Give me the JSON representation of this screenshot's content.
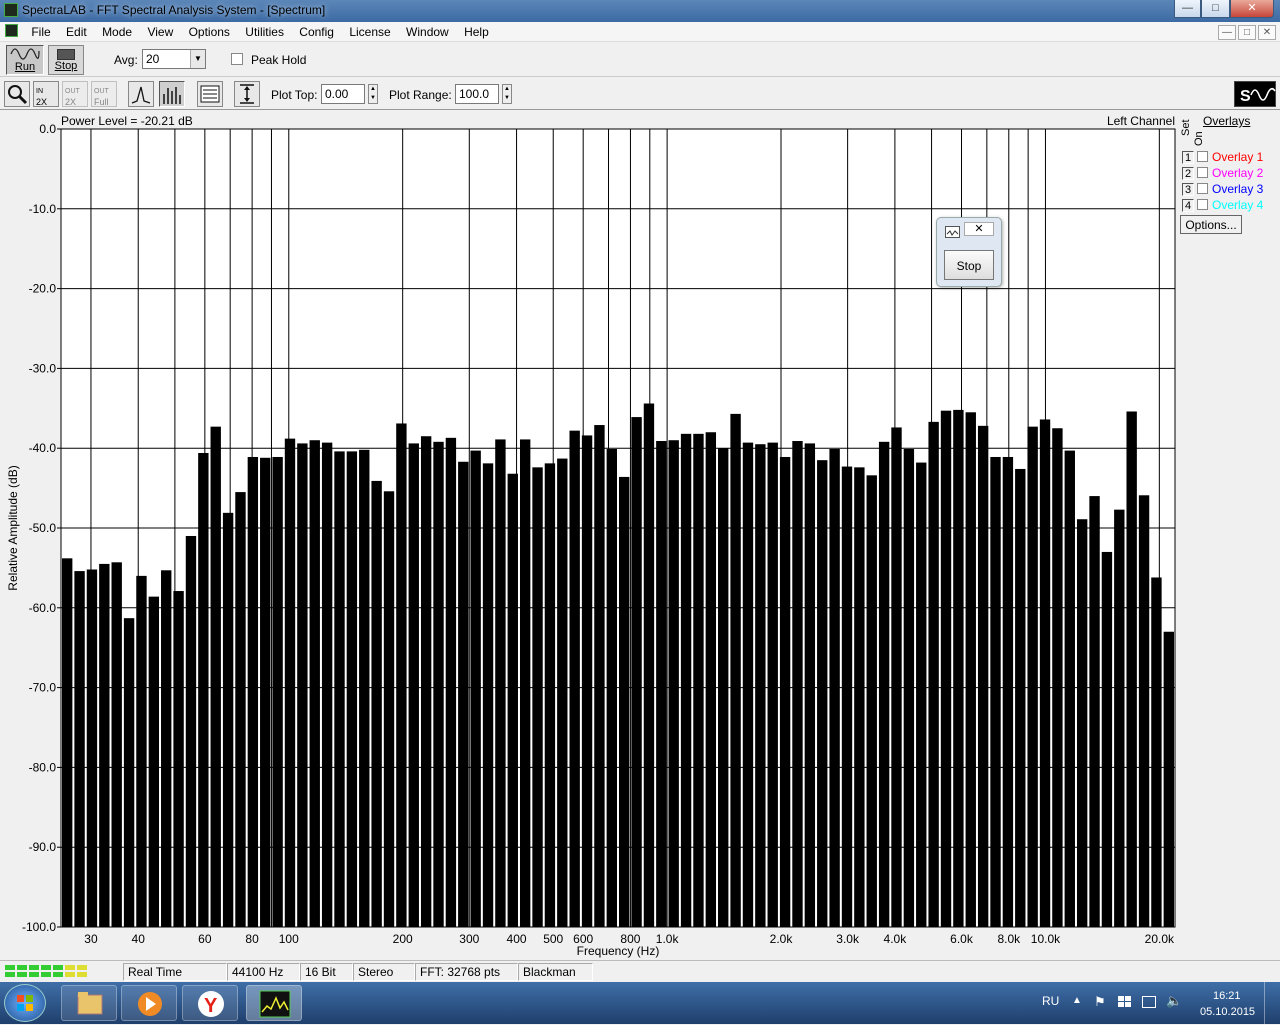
{
  "window": {
    "title": "SpectraLAB - FFT Spectral Analysis System - [Spectrum]",
    "btn_min": "—",
    "btn_max": "□",
    "btn_close": "✕"
  },
  "menu": {
    "items": [
      "File",
      "Edit",
      "Mode",
      "View",
      "Options",
      "Utilities",
      "Config",
      "License",
      "Window",
      "Help"
    ]
  },
  "toolbar1": {
    "run_label": "Run",
    "stop_label": "Stop",
    "avg_label": "Avg:",
    "avg_value": "20",
    "peak_hold_label": "Peak Hold",
    "peak_hold_checked": false
  },
  "toolbar2": {
    "icons": [
      "zoom-icon",
      "zoom-in-2x-icon",
      "zoom-out-2x-icon",
      "zoom-out-full-icon",
      "line-mode-icon",
      "bar-mode-icon",
      "settings-panel-icon",
      "vertical-scale-icon"
    ],
    "icon_texts": {
      "zin": "2X",
      "zout": "2X",
      "zfull": "Full"
    },
    "plot_top_label": "Plot Top:",
    "plot_top_value": "0.00",
    "plot_range_label": "Plot Range:",
    "plot_range_value": "100.0"
  },
  "plot": {
    "power_level": "Power Level = -20.21 dB",
    "channel": "Left Channel"
  },
  "overlays": {
    "title": "Overlays",
    "col_set": "Set",
    "col_on": "On",
    "items": [
      {
        "num": "1",
        "label": "Overlay 1",
        "color": "#ff0000",
        "checked": false
      },
      {
        "num": "2",
        "label": "Overlay 2",
        "color": "#ff00ff",
        "checked": false
      },
      {
        "num": "3",
        "label": "Overlay 3",
        "color": "#0000ff",
        "checked": false
      },
      {
        "num": "4",
        "label": "Overlay 4",
        "color": "#00ffff",
        "checked": false
      }
    ],
    "options_label": "Options..."
  },
  "popup": {
    "stop_label": "Stop",
    "close": "✕"
  },
  "status": {
    "mode": "Real Time",
    "rate": "44100 Hz",
    "bits": "16 Bit",
    "channels": "Stereo",
    "fft": "FFT: 32768 pts",
    "window": "Blackman"
  },
  "taskbar": {
    "lang": "RU",
    "time": "16:21",
    "date": "05.10.2015"
  },
  "chart_data": {
    "type": "bar",
    "xlabel": "Frequency (Hz)",
    "ylabel": "Relative Amplitude (dB)",
    "xscale": "log",
    "xlim": [
      25,
      22000
    ],
    "ylim": [
      -100,
      0
    ],
    "ytick_labels": [
      "0.0",
      "-10.0",
      "-20.0",
      "-30.0",
      "-40.0",
      "-50.0",
      "-60.0",
      "-70.0",
      "-80.0",
      "-90.0",
      "-100.0"
    ],
    "xtick_labels": [
      {
        "v": 30,
        "t": "30"
      },
      {
        "v": 40,
        "t": "40"
      },
      {
        "v": 60,
        "t": "60"
      },
      {
        "v": 80,
        "t": "80"
      },
      {
        "v": 100,
        "t": "100"
      },
      {
        "v": 200,
        "t": "200"
      },
      {
        "v": 300,
        "t": "300"
      },
      {
        "v": 400,
        "t": "400"
      },
      {
        "v": 500,
        "t": "500"
      },
      {
        "v": 600,
        "t": "600"
      },
      {
        "v": 800,
        "t": "800"
      },
      {
        "v": 1000,
        "t": "1.0k"
      },
      {
        "v": 2000,
        "t": "2.0k"
      },
      {
        "v": 3000,
        "t": "3.0k"
      },
      {
        "v": 4000,
        "t": "4.0k"
      },
      {
        "v": 6000,
        "t": "6.0k"
      },
      {
        "v": 8000,
        "t": "8.0k"
      },
      {
        "v": 10000,
        "t": "10.0k"
      },
      {
        "v": 20000,
        "t": "20.0k"
      }
    ],
    "grid_lines_x": [
      30,
      40,
      50,
      60,
      70,
      80,
      90,
      100,
      200,
      300,
      400,
      500,
      600,
      700,
      800,
      900,
      1000,
      2000,
      3000,
      4000,
      5000,
      6000,
      7000,
      8000,
      9000,
      10000,
      20000
    ],
    "grid": true,
    "freq_start": 25,
    "freq_end": 22000,
    "values": [
      -53.8,
      -55.4,
      -55.2,
      -54.5,
      -54.3,
      -61.3,
      -56.0,
      -58.6,
      -55.3,
      -57.9,
      -51.0,
      -40.6,
      -37.3,
      -48.1,
      -45.5,
      -41.1,
      -41.2,
      -41.1,
      -38.8,
      -39.4,
      -39.0,
      -39.3,
      -40.4,
      -40.4,
      -40.2,
      -44.1,
      -45.4,
      -36.9,
      -39.4,
      -38.5,
      -39.2,
      -38.7,
      -41.7,
      -40.3,
      -41.9,
      -38.9,
      -43.2,
      -38.9,
      -42.4,
      -41.9,
      -41.3,
      -37.8,
      -38.4,
      -37.1,
      -40.1,
      -43.6,
      -36.1,
      -34.4,
      -39.1,
      -39.0,
      -38.2,
      -38.2,
      -38.0,
      -40.0,
      -35.7,
      -39.3,
      -39.5,
      -39.3,
      -41.1,
      -39.1,
      -39.4,
      -41.5,
      -40.1,
      -42.3,
      -42.4,
      -43.4,
      -39.2,
      -37.4,
      -40.1,
      -41.8,
      -36.7,
      -35.3,
      -35.2,
      -35.5,
      -37.2,
      -41.1,
      -41.1,
      -42.6,
      -37.3,
      -36.4,
      -37.5,
      -40.3,
      -48.9,
      -46.0,
      -53.0,
      -47.7,
      -35.4,
      -45.9,
      -56.2,
      -63.0
    ]
  }
}
